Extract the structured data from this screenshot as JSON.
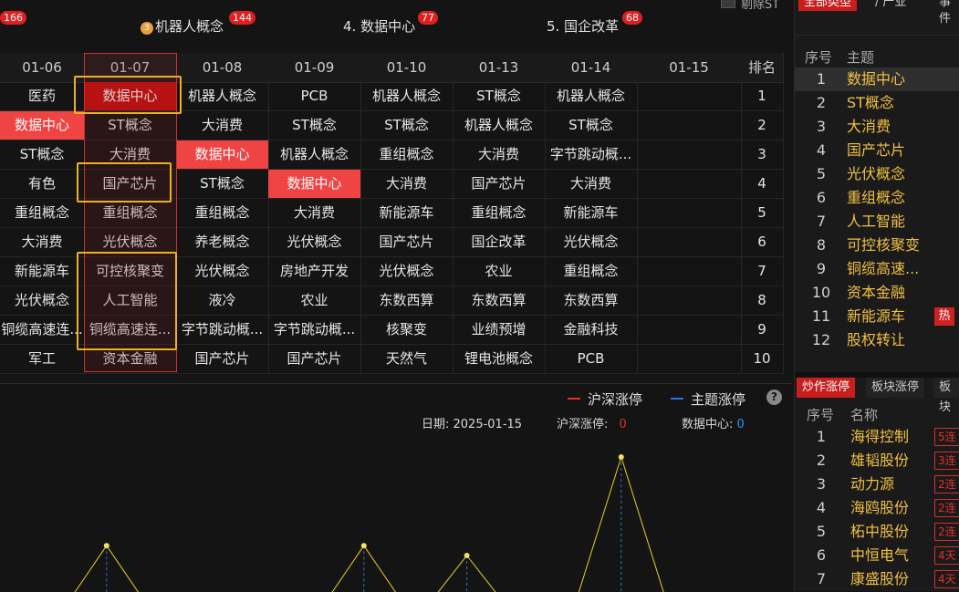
{
  "top": {
    "item0_badge": "166",
    "item1_label": "机器人概念",
    "item1_badge": "144",
    "item2_label": "4. 数据中心",
    "item2_badge": "77",
    "item3_label": "5. 国企改革",
    "item3_badge": "68",
    "exclude_st_label": "剔除ST"
  },
  "grid": {
    "headers": [
      "01-06",
      "01-07",
      "01-08",
      "01-09",
      "01-10",
      "01-13",
      "01-14",
      "01-15",
      "排名"
    ],
    "rows": [
      [
        "医药",
        "数据中心",
        "机器人概念",
        "PCB",
        "机器人概念",
        "ST概念",
        "机器人概念",
        "",
        "1"
      ],
      [
        "数据中心",
        "ST概念",
        "大消费",
        "ST概念",
        "ST概念",
        "机器人概念",
        "ST概念",
        "",
        "2"
      ],
      [
        "ST概念",
        "大消费",
        "数据中心",
        "机器人概念",
        "重组概念",
        "大消费",
        "字节跳动概...",
        "",
        "3"
      ],
      [
        "有色",
        "国产芯片",
        "ST概念",
        "数据中心",
        "大消费",
        "国产芯片",
        "大消费",
        "",
        "4"
      ],
      [
        "重组概念",
        "重组概念",
        "重组概念",
        "大消费",
        "新能源车",
        "重组概念",
        "新能源车",
        "",
        "5"
      ],
      [
        "大消费",
        "光伏概念",
        "养老概念",
        "光伏概念",
        "国产芯片",
        "国企改革",
        "光伏概念",
        "",
        "6"
      ],
      [
        "新能源车",
        "可控核聚变",
        "光伏概念",
        "房地产开发",
        "光伏概念",
        "农业",
        "重组概念",
        "",
        "7"
      ],
      [
        "光伏概念",
        "人工智能",
        "液冷",
        "农业",
        "东数西算",
        "东数西算",
        "东数西算",
        "",
        "8"
      ],
      [
        "铜缆高速连...",
        "铜缆高速连...",
        "字节跳动概...",
        "字节跳动概...",
        "核聚变",
        "业绩预增",
        "金融科技",
        "",
        "9"
      ],
      [
        "军工",
        "资本金融",
        "国产芯片",
        "国产芯片",
        "天然气",
        "锂电池概念",
        "PCB",
        "",
        "10"
      ]
    ]
  },
  "chart": {
    "legend_red": "沪深涨停",
    "legend_blue": "主题涨停",
    "help": "?",
    "date_label": "日期: 2025-01-15",
    "hs_label": "沪深涨停:",
    "hs_value": "0",
    "theme_label": "数据中心:",
    "theme_value": "0"
  },
  "chart_data": {
    "type": "line",
    "series": [
      {
        "name": "主题涨停",
        "values": [
          0,
          0,
          0.46,
          0,
          0,
          0,
          0,
          0.46,
          0,
          0.4,
          0,
          0,
          1.0,
          0,
          0
        ]
      }
    ]
  },
  "colors": {
    "highlight": "#f04444",
    "selected": "#c80f0f",
    "accent_yellow": "#f0c040",
    "box": "#f0b020",
    "line": "#e8d020"
  },
  "right": {
    "tab1": "全部类型",
    "tab2": "产业",
    "tab3": "事件",
    "head_num": "序号",
    "head_topic": "主题",
    "topics": [
      "数据中心",
      "ST概念",
      "大消费",
      "国产芯片",
      "光伏概念",
      "重组概念",
      "人工智能",
      "可控核聚变",
      "铜缆高速...",
      "资本金融",
      "新能源车",
      "股权转让"
    ],
    "topic_nums": [
      "1",
      "2",
      "3",
      "4",
      "5",
      "6",
      "7",
      "8",
      "9",
      "10",
      "11",
      "12"
    ],
    "hot_label": "热",
    "tabs2": [
      "炒作涨停",
      "板块涨停",
      "板块"
    ],
    "head_num2": "序号",
    "head_name": "名称",
    "stocks": [
      "海得控制",
      "雄韬股份",
      "动力源",
      "海鸥股份",
      "柘中股份",
      "中恒电气",
      "康盛股份"
    ],
    "stock_nums": [
      "1",
      "2",
      "3",
      "4",
      "5",
      "6",
      "7"
    ],
    "stock_tags": [
      "5连",
      "3连",
      "2连",
      "2连",
      "2连",
      "4天",
      "4天"
    ]
  }
}
